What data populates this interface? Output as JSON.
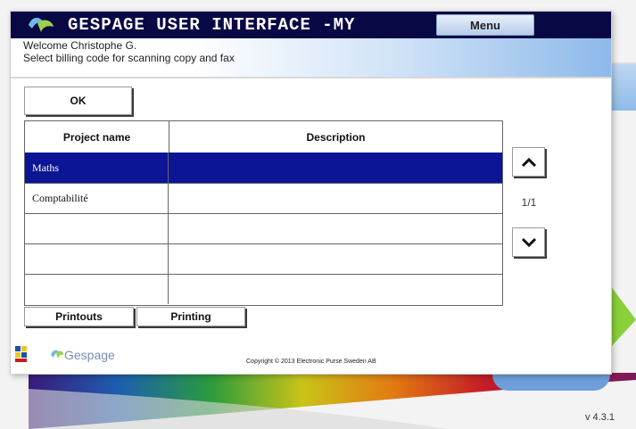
{
  "header": {
    "title": "GESPAGE USER INTERFACE -MY",
    "menu_label": "Menu"
  },
  "welcome": {
    "line1": "Welcome Christophe G.",
    "line2": "Select billing code for scanning copy and fax"
  },
  "actions": {
    "ok_label": "OK",
    "printouts_label": "Printouts",
    "printing_label": "Printing"
  },
  "table": {
    "columns": [
      "Project name",
      "Description"
    ],
    "rows": [
      {
        "project": "Maths",
        "description": "",
        "selected": true
      },
      {
        "project": "Comptabilité",
        "description": "",
        "selected": false
      },
      {
        "project": "",
        "description": "",
        "selected": false
      },
      {
        "project": "",
        "description": "",
        "selected": false
      },
      {
        "project": "",
        "description": "",
        "selected": false
      }
    ]
  },
  "pagination": {
    "page_indicator": "1/1",
    "up_icon": "chevron-up-icon",
    "down_icon": "chevron-down-icon"
  },
  "footer": {
    "brand": "Gespage",
    "copyright": "Copyright © 2013 Electronic Purse Sweden AB"
  },
  "version": "v 4.3.1",
  "colors": {
    "title_bar": "#080845",
    "selected_row": "#0b1595",
    "welcome_gradient_end": "#8db9ea"
  }
}
